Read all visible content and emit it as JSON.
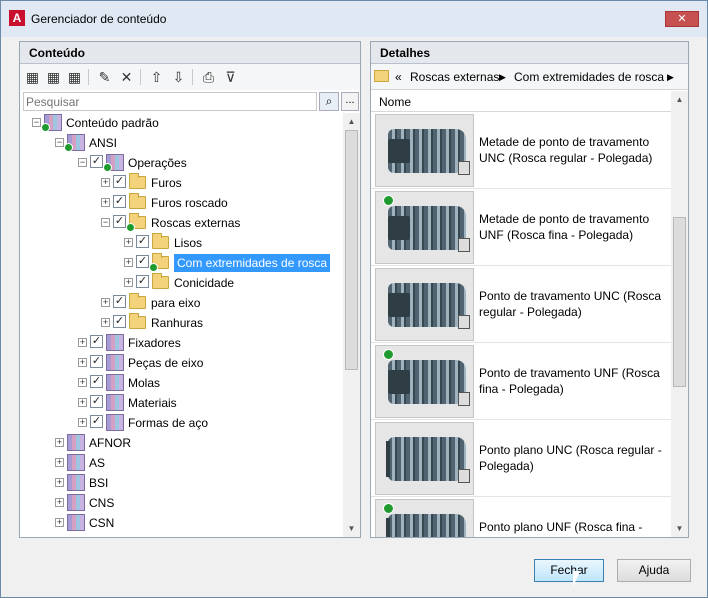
{
  "window": {
    "title": "Gerenciador de conteúdo",
    "close_label": "✕"
  },
  "left_pane": {
    "header": "Conteúdo",
    "search_placeholder": "Pesquisar",
    "more_label": "...",
    "tree": [
      {
        "label": "Conteúdo padrão",
        "level": 0,
        "type": "book",
        "expander": "−",
        "checked": null,
        "badge": true
      },
      {
        "label": "ANSI",
        "level": 1,
        "type": "book",
        "expander": "−",
        "checked": null,
        "badge": true
      },
      {
        "label": "Operações",
        "level": 2,
        "type": "book",
        "expander": "−",
        "checked": true,
        "badge": true
      },
      {
        "label": "Furos",
        "level": 3,
        "type": "folder",
        "expander": "+",
        "checked": true,
        "badge": false
      },
      {
        "label": "Furos roscado",
        "level": 3,
        "type": "folder",
        "expander": "+",
        "checked": true,
        "badge": false
      },
      {
        "label": "Roscas externas",
        "level": 3,
        "type": "folder",
        "expander": "−",
        "checked": true,
        "badge": true
      },
      {
        "label": "Lisos",
        "level": 4,
        "type": "folder",
        "expander": "+",
        "checked": true,
        "badge": false
      },
      {
        "label": "Com extremidades de rosca",
        "level": 4,
        "type": "folder",
        "expander": "+",
        "checked": true,
        "badge": true,
        "selected": true
      },
      {
        "label": "Conicidade",
        "level": 4,
        "type": "folder",
        "expander": "+",
        "checked": true,
        "badge": false
      },
      {
        "label": "para eixo",
        "level": 3,
        "type": "folder",
        "expander": "+",
        "checked": true,
        "badge": false
      },
      {
        "label": "Ranhuras",
        "level": 3,
        "type": "folder",
        "expander": "+",
        "checked": true,
        "badge": false
      },
      {
        "label": "Fixadores",
        "level": 2,
        "type": "book",
        "expander": "+",
        "checked": true,
        "badge": false
      },
      {
        "label": "Peças de eixo",
        "level": 2,
        "type": "book",
        "expander": "+",
        "checked": true,
        "badge": false
      },
      {
        "label": "Molas",
        "level": 2,
        "type": "book",
        "expander": "+",
        "checked": true,
        "badge": false
      },
      {
        "label": "Materiais",
        "level": 2,
        "type": "book",
        "expander": "+",
        "checked": true,
        "badge": false
      },
      {
        "label": "Formas de aço",
        "level": 2,
        "type": "book",
        "expander": "+",
        "checked": true,
        "badge": false
      },
      {
        "label": "AFNOR",
        "level": 1,
        "type": "book",
        "expander": "+",
        "checked": null,
        "badge": false
      },
      {
        "label": "AS",
        "level": 1,
        "type": "book",
        "expander": "+",
        "checked": null,
        "badge": false
      },
      {
        "label": "BSI",
        "level": 1,
        "type": "book",
        "expander": "+",
        "checked": null,
        "badge": false
      },
      {
        "label": "CNS",
        "level": 1,
        "type": "book",
        "expander": "+",
        "checked": null,
        "badge": false
      },
      {
        "label": "CSN",
        "level": 1,
        "type": "book",
        "expander": "+",
        "checked": null,
        "badge": false
      }
    ]
  },
  "right_pane": {
    "header": "Detalhes",
    "breadcrumb": [
      "Roscas externas",
      "Com extremidades de rosca"
    ],
    "column_header": "Nome",
    "items": [
      {
        "name": "Metade de ponto de travamento UNC (Rosca regular - Polegada)",
        "badge": false,
        "style": "half"
      },
      {
        "name": "Metade de ponto de travamento UNF (Rosca fina - Polegada)",
        "badge": true,
        "style": "half"
      },
      {
        "name": "Ponto de travamento UNC (Rosca regular - Polegada)",
        "badge": false,
        "style": "half"
      },
      {
        "name": "Ponto de travamento UNF (Rosca fina - Polegada)",
        "badge": true,
        "style": "half"
      },
      {
        "name": "Ponto plano UNC (Rosca regular - Polegada)",
        "badge": false,
        "style": "flat"
      },
      {
        "name": "Ponto plano UNF (Rosca fina - Polegada)",
        "badge": true,
        "style": "flat"
      }
    ]
  },
  "buttons": {
    "close": "Fechar",
    "help": "Ajuda"
  },
  "colors": {
    "selection": "#3399ff",
    "ok_badge": "#1f9a2e",
    "close_button": "#c75050"
  }
}
